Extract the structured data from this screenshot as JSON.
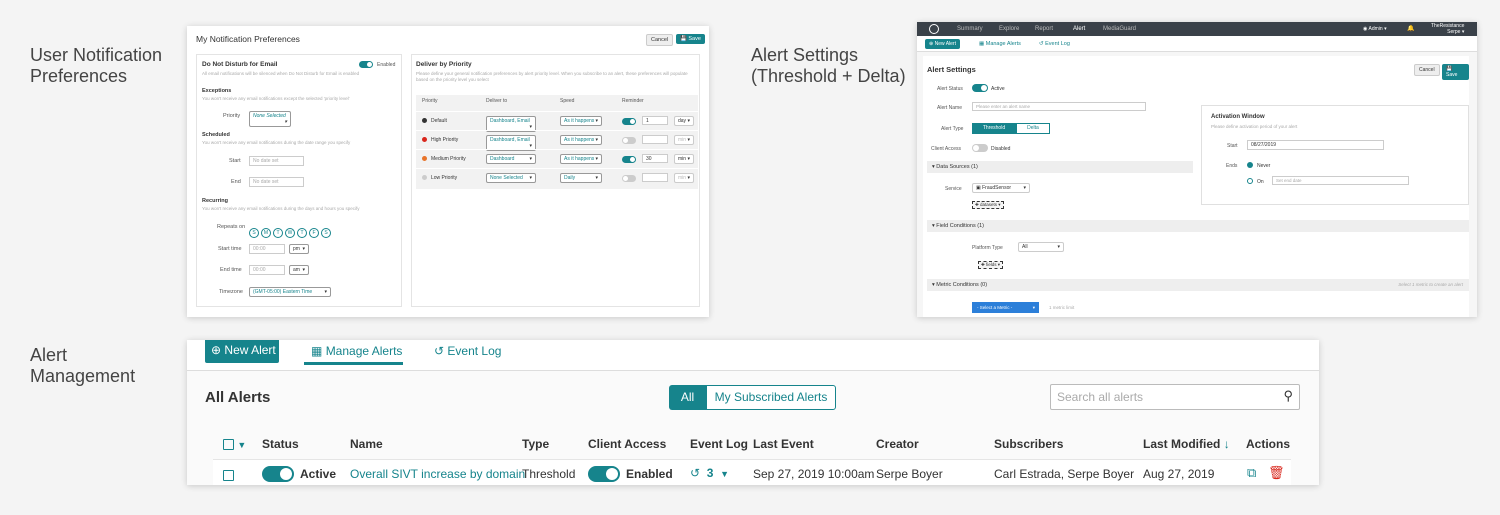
{
  "captions": {
    "c1": [
      "User Notification",
      "Preferences"
    ],
    "c2": [
      "Alert Settings",
      "(Threshold + Delta)"
    ],
    "c3": [
      "Alert",
      "Management"
    ]
  },
  "notif": {
    "title": "My Notification Preferences",
    "cancel": "Cancel",
    "save": "Save",
    "dnd_title": "Do Not Disturb for Email",
    "dnd_toggle": "Enabled",
    "dnd_desc": "All email notifications will be silenced when Do Not Disturb for Email is enabled",
    "exceptions": "Exceptions",
    "exceptions_desc": "You won't receive any email notifications except the selected 'priority level'",
    "priority_label": "Priority",
    "priority_value": "None Selected",
    "scheduled": "Scheduled",
    "scheduled_desc": "You won't receive any email notifications during the date range you specify",
    "start_label": "Start",
    "end_label": "End",
    "date_placeholder": "No date set",
    "recurring": "Recurring",
    "recurring_desc": "You won't receive any email notifications during the days and hours you specify",
    "repeats_label": "Repeats on",
    "days": [
      "S",
      "M",
      "T",
      "W",
      "T",
      "F",
      "S"
    ],
    "start_time_label": "Start time",
    "end_time_label": "End time",
    "time_placeholder": "00:00",
    "start_ampm": "pm",
    "end_ampm": "am",
    "timezone_label": "Timezone",
    "timezone_value": "(GMT-05:00) Eastern Time",
    "deliver_title": "Deliver by Priority",
    "deliver_desc": "Please define your general notification preferences by alert priority level. When you subscribe to an alert, these preferences will populate based on the priority level you select",
    "headers": [
      "Priority",
      "Deliver to",
      "Speed",
      "Reminder"
    ],
    "rows": [
      {
        "priority": "Default",
        "color": "#333333",
        "deliver": "Dashboard, Email",
        "speed": "As it happens",
        "reminder_on": true,
        "num": "1",
        "unit": "day"
      },
      {
        "priority": "High Priority",
        "color": "#d9261c",
        "deliver": "Dashboard, Email",
        "speed": "As it happens",
        "reminder_on": false,
        "num": "",
        "unit": "min"
      },
      {
        "priority": "Medium Priority",
        "color": "#e8742a",
        "deliver": "Dashboard",
        "speed": "As it happens",
        "reminder_on": true,
        "num": "30",
        "unit": "min"
      },
      {
        "priority": "Low Priority",
        "color": "#cccccc",
        "deliver": "None Selected",
        "speed": "Daily",
        "reminder_on": false,
        "num": "",
        "unit": "min"
      }
    ]
  },
  "settings": {
    "nav": [
      "Summary",
      "Explore",
      "Report",
      "Alert",
      "MediaGuard"
    ],
    "admin": "Admin",
    "org": "TheResistance",
    "user": "Serpe",
    "sub_new": "New Alert",
    "sub_manage": "Manage Alerts",
    "sub_log": "Event Log",
    "title": "Alert Settings",
    "cancel": "Cancel",
    "save": "Save",
    "status_label": "Alert Status",
    "status_value": "Active",
    "name_label": "Alert Name",
    "name_placeholder": "Please enter an alert name",
    "type_label": "Alert Type",
    "type_threshold": "Threshold",
    "type_delta": "Delta",
    "client_label": "Client Access",
    "client_value": "Disabled",
    "ds_title": "Data Sources (1)",
    "service_label": "Service",
    "service_value": "FraudSensor",
    "datasets": "datasets",
    "fc_title": "Field Conditions (1)",
    "platform_label": "Platform Type",
    "platform_value": "All",
    "fields": "fields",
    "mc_title": "Metric Conditions (0)",
    "mc_hint": "Select 1 metric to create an alert",
    "metric_select": "- Select a Metric -",
    "metric_limit": "1 metric limit",
    "aw_title": "Activation Window",
    "aw_desc": "Please define activation period of your alert",
    "aw_start_label": "Start",
    "aw_start_value": "08/27/2019",
    "aw_ends_label": "Ends",
    "aw_never": "Never",
    "aw_on": "On",
    "aw_end_placeholder": "Set end date"
  },
  "manage": {
    "new_alert": "New Alert",
    "manage_tab": "Manage Alerts",
    "log_tab": "Event Log",
    "title": "All Alerts",
    "filter_all": "All",
    "filter_mine": "My Subscribed Alerts",
    "search_placeholder": "Search all alerts",
    "columns": [
      "Status",
      "Name",
      "Type",
      "Client Access",
      "Event Log",
      "Last Event",
      "Creator",
      "Subscribers",
      "Last Modified",
      "Actions"
    ],
    "row": {
      "status": "Active",
      "name": "Overall SIVT increase by domain",
      "type": "Threshold",
      "client": "Enabled",
      "events": "3",
      "last_event": "Sep 27, 2019 10:00am",
      "creator": "Serpe Boyer",
      "subscribers": "Carl Estrada, Serpe Boyer",
      "modified": "Aug 27, 2019"
    }
  },
  "colors": {
    "accent": "#16848c",
    "danger": "#d9261c"
  }
}
